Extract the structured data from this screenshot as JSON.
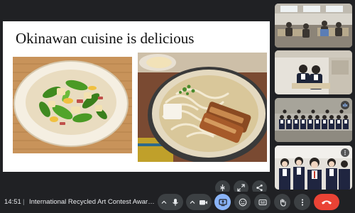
{
  "slide": {
    "title": "Okinawan cuisine is delicious"
  },
  "photos": {
    "left": "goya-champuru-photo",
    "right": "okinawa-soba-photo"
  },
  "stage_actions": [
    {
      "name": "unpin-button",
      "icon": "unpin-icon"
    },
    {
      "name": "fullscreen-button",
      "icon": "expand-icon"
    },
    {
      "name": "share-screen-options-button",
      "icon": "share-icon"
    }
  ],
  "participants": [
    {
      "tile": "participant-tile-1",
      "scene": "classroom"
    },
    {
      "tile": "participant-tile-2",
      "scene": "two-students"
    },
    {
      "tile": "participant-tile-3",
      "scene": "group-photo",
      "badge": "speaking-icon"
    },
    {
      "tile": "participant-tile-4",
      "scene": "students-close",
      "badge": "more-icon"
    }
  ],
  "bottom_bar": {
    "time": "14:51",
    "separator": "|",
    "meeting_title": "International Recycled Art Contest Awards ..."
  },
  "controls": [
    {
      "name": "mic-menu",
      "icon": "mic-icon"
    },
    {
      "name": "camera-menu",
      "icon": "camera-icon"
    },
    {
      "name": "present-button",
      "icon": "present-icon",
      "active": true
    },
    {
      "name": "reactions-button",
      "icon": "emoji-icon"
    },
    {
      "name": "captions-button",
      "icon": "captions-icon"
    },
    {
      "name": "raise-hand-button",
      "icon": "hand-icon"
    },
    {
      "name": "more-options-button",
      "icon": "more-vert-icon"
    },
    {
      "name": "leave-call-button",
      "icon": "end-call-icon"
    }
  ],
  "colors": {
    "background": "#202124",
    "control": "#3c4043",
    "active": "#8ab4f8",
    "end_call": "#ea4335"
  }
}
